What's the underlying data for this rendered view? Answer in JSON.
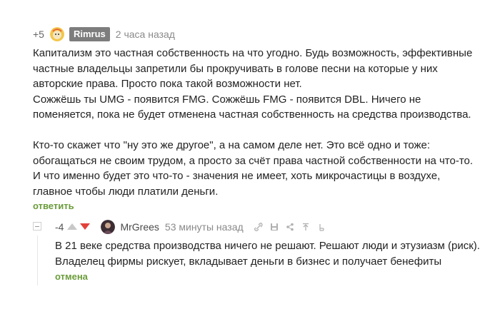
{
  "comment": {
    "rating": "+5",
    "author": "Rimrus",
    "time": "2 часа назад",
    "avatar_icon": "user-avatar-icon",
    "paragraphs": [
      "Капитализм это частная собственность на что угодно. Будь возможность, эффективные частные владельцы запретили бы прокручивать в голове песни на которые у них авторские права. Просто пока такой возможности нет.",
      "Сожжёшь ты UMG - появится FMG. Сожжёшь FMG - появится DBL. Ничего не поменяется, пока не будет отменена частная собственность на средства производства.",
      "",
      "Кто-то скажет что \"ну это же другое\", а на самом деле нет. Это всё одно и тоже: обогащаться не своим трудом, а просто за счёт права частной собственности на что-то.",
      "И что именно будет это что-то - значения не имеет, хоть микрочастицы в воздухе, главное чтобы люди платили деньги."
    ],
    "reply_label": "ответить"
  },
  "reply": {
    "rating": "-4",
    "author": "MrGrees",
    "time": "53 минуты назад",
    "avatar_icon": "user-avatar-icon",
    "upvote_icon": "arrow-up-icon",
    "downvote_icon": "arrow-down-icon",
    "tools": [
      "link-icon",
      "save-icon",
      "share-icon",
      "pin-icon",
      "bookmark-icon"
    ],
    "text": "В 21 веке средства производства ничего не решают. Решают люди и этузиазм (риск). Владелец фирмы рискует, вкладывает деньги в бизнес и получает бенефиты",
    "cancel_label": "отмена"
  },
  "colors": {
    "accent_link": "#6a9c3a",
    "author_badge": "#7d7d7d",
    "downvote": "#e2413b"
  }
}
